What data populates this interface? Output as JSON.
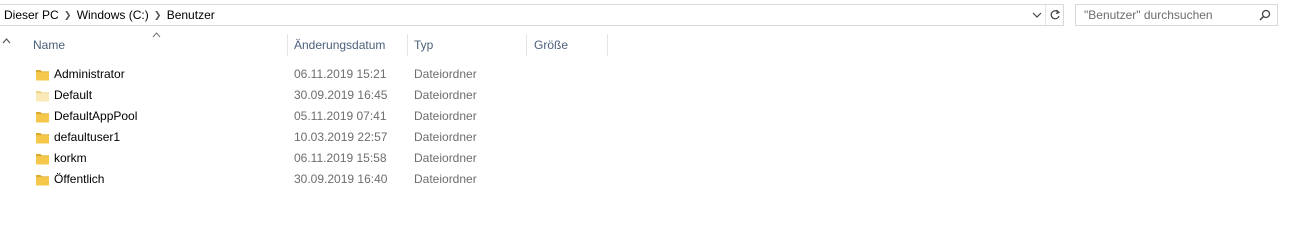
{
  "address_bar": {
    "breadcrumbs": [
      "Dieser PC",
      "Windows (C:)",
      "Benutzer"
    ],
    "separator_icon": "chevron-right-icon",
    "dropdown_icon": "chevron-down-icon",
    "refresh_icon": "refresh-icon"
  },
  "search": {
    "placeholder": "\"Benutzer\" durchsuchen",
    "icon": "search-icon"
  },
  "nav_pane": {
    "collapse_icon": "chevron-up-icon"
  },
  "columns": {
    "name": "Name",
    "date": "Änderungsdatum",
    "type": "Typ",
    "size": "Größe",
    "sorted_by": "name",
    "sort_icon": "sort-ascending-icon"
  },
  "files": [
    {
      "name": "Administrator",
      "date": "06.11.2019 15:21",
      "type": "Dateiordner",
      "size": "",
      "hidden": false
    },
    {
      "name": "Default",
      "date": "30.09.2019 16:45",
      "type": "Dateiordner",
      "size": "",
      "hidden": true
    },
    {
      "name": "DefaultAppPool",
      "date": "05.11.2019 07:41",
      "type": "Dateiordner",
      "size": "",
      "hidden": false
    },
    {
      "name": "defaultuser1",
      "date": "10.03.2019 22:57",
      "type": "Dateiordner",
      "size": "",
      "hidden": false
    },
    {
      "name": "korkm",
      "date": "06.11.2019 15:58",
      "type": "Dateiordner",
      "size": "",
      "hidden": false
    },
    {
      "name": "Öffentlich",
      "date": "30.09.2019 16:40",
      "type": "Dateiordner",
      "size": "",
      "hidden": false
    }
  ],
  "colors": {
    "folder": "#f5c84c",
    "folder_dark": "#dcab2d",
    "folder_hidden": "#faeab8",
    "header_text": "#4c607a",
    "secondary_text": "#6d6d6d"
  }
}
